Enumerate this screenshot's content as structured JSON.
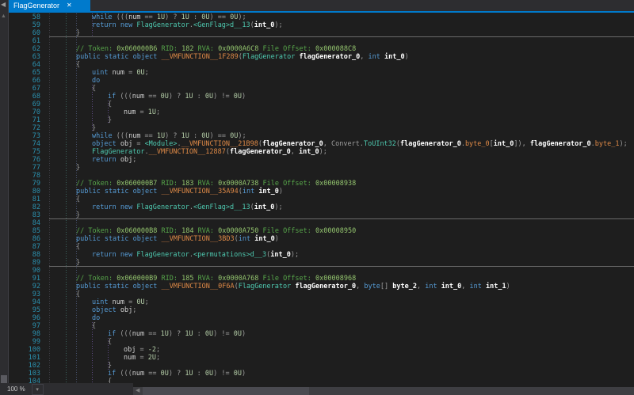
{
  "colors": {
    "accent": "#007ACC",
    "linenum": "#2B91AF",
    "keyword": "#569CD6",
    "type": "#4EC9B0",
    "member": "#DF8A47",
    "parameter": "#FFFFFF",
    "local": "#D4D4D4",
    "punctuation": "#9E9E9E",
    "number": "#B5CEA8",
    "comment": "#57A64A",
    "comment_number": "#93C46E"
  },
  "icons": {
    "tab_close": "✕",
    "dropdown_caret": "▾",
    "scroll_left": "◀",
    "scroll_up": "▲",
    "strip_chevron_left": "◀"
  },
  "tab_bar": {
    "tabs": [
      {
        "label": "FlagGenerator",
        "active": true
      }
    ]
  },
  "status_bar": {
    "zoom_level": "100 %"
  },
  "editor": {
    "first_line": 58,
    "lines": [
      {
        "n": 58,
        "i": 1,
        "s": [
          [
            "k",
            "while"
          ],
          [
            "o",
            " ((("
          ],
          [
            "v",
            "num"
          ],
          [
            "o",
            " == "
          ],
          [
            "n",
            "1U"
          ],
          [
            "o",
            ") ? "
          ],
          [
            "n",
            "1U"
          ],
          [
            "o",
            " : "
          ],
          [
            "n",
            "0U"
          ],
          [
            "o",
            ") == "
          ],
          [
            "n",
            "0U"
          ],
          [
            "o",
            ");"
          ]
        ]
      },
      {
        "n": 59,
        "i": 1,
        "s": [
          [
            "k",
            "return"
          ],
          [
            "o",
            " "
          ],
          [
            "k",
            "new"
          ],
          [
            "o",
            " "
          ],
          [
            "t",
            "FlagGenerator"
          ],
          [
            "o",
            "."
          ],
          [
            "t",
            "<GenFlag>d__13"
          ],
          [
            "o",
            "("
          ],
          [
            "p",
            "int_0"
          ],
          [
            "o",
            ");"
          ]
        ]
      },
      {
        "n": 60,
        "i": 0,
        "sep": true,
        "s": [
          [
            "o",
            "}"
          ]
        ]
      },
      {
        "n": 61
      },
      {
        "n": 62,
        "i": 0,
        "s": [
          [
            "c",
            "// Token: "
          ],
          [
            "d",
            "0x060000B6"
          ],
          [
            "c",
            " RID: "
          ],
          [
            "d",
            "182"
          ],
          [
            "c",
            " RVA: "
          ],
          [
            "d",
            "0x0000A6C8"
          ],
          [
            "c",
            " File Offset: "
          ],
          [
            "d",
            "0x000088C8"
          ]
        ]
      },
      {
        "n": 63,
        "i": 0,
        "s": [
          [
            "k",
            "public static object "
          ],
          [
            "m",
            "__VMFUNCTION__1F289"
          ],
          [
            "o",
            "("
          ],
          [
            "t",
            "FlagGenerator"
          ],
          [
            "o",
            " "
          ],
          [
            "p",
            "flagGenerator_0"
          ],
          [
            "o",
            ", "
          ],
          [
            "k",
            "int"
          ],
          [
            "o",
            " "
          ],
          [
            "p",
            "int_0"
          ],
          [
            "o",
            ")"
          ]
        ]
      },
      {
        "n": 64,
        "i": 0,
        "s": [
          [
            "o",
            "{"
          ]
        ]
      },
      {
        "n": 65,
        "i": 1,
        "s": [
          [
            "k",
            "uint"
          ],
          [
            "o",
            " "
          ],
          [
            "v",
            "num"
          ],
          [
            "o",
            " = "
          ],
          [
            "n",
            "0U"
          ],
          [
            "o",
            ";"
          ]
        ]
      },
      {
        "n": 66,
        "i": 1,
        "s": [
          [
            "k",
            "do"
          ]
        ]
      },
      {
        "n": 67,
        "i": 1,
        "s": [
          [
            "o",
            "{"
          ]
        ]
      },
      {
        "n": 68,
        "i": 2,
        "s": [
          [
            "k",
            "if"
          ],
          [
            "o",
            " ((("
          ],
          [
            "v",
            "num"
          ],
          [
            "o",
            " == "
          ],
          [
            "n",
            "0U"
          ],
          [
            "o",
            ") ? "
          ],
          [
            "n",
            "1U"
          ],
          [
            "o",
            " : "
          ],
          [
            "n",
            "0U"
          ],
          [
            "o",
            ") != "
          ],
          [
            "n",
            "0U"
          ],
          [
            "o",
            ")"
          ]
        ]
      },
      {
        "n": 69,
        "i": 2,
        "s": [
          [
            "o",
            "{"
          ]
        ]
      },
      {
        "n": 70,
        "i": 3,
        "s": [
          [
            "v",
            "num"
          ],
          [
            "o",
            " = "
          ],
          [
            "n",
            "1U"
          ],
          [
            "o",
            ";"
          ]
        ]
      },
      {
        "n": 71,
        "i": 2,
        "s": [
          [
            "o",
            "}"
          ]
        ]
      },
      {
        "n": 72,
        "i": 1,
        "s": [
          [
            "o",
            "}"
          ]
        ]
      },
      {
        "n": 73,
        "i": 1,
        "s": [
          [
            "k",
            "while"
          ],
          [
            "o",
            " ((("
          ],
          [
            "v",
            "num"
          ],
          [
            "o",
            " == "
          ],
          [
            "n",
            "1U"
          ],
          [
            "o",
            ") ? "
          ],
          [
            "n",
            "1U"
          ],
          [
            "o",
            " : "
          ],
          [
            "n",
            "0U"
          ],
          [
            "o",
            ") == "
          ],
          [
            "n",
            "0U"
          ],
          [
            "o",
            ");"
          ]
        ]
      },
      {
        "n": 74,
        "i": 1,
        "s": [
          [
            "k",
            "object"
          ],
          [
            "o",
            " "
          ],
          [
            "v",
            "obj"
          ],
          [
            "o",
            " = "
          ],
          [
            "t",
            "<Module>"
          ],
          [
            "o",
            "."
          ],
          [
            "m",
            "__VMFUNCTION__21B98"
          ],
          [
            "o",
            "("
          ],
          [
            "p",
            "flagGenerator_0"
          ],
          [
            "o",
            ", "
          ],
          [
            "o",
            "Convert"
          ],
          [
            "o",
            "."
          ],
          [
            "t",
            "ToUInt32"
          ],
          [
            "o",
            "("
          ],
          [
            "p",
            "flagGenerator_0"
          ],
          [
            "o",
            "."
          ],
          [
            "m",
            "byte_0"
          ],
          [
            "o",
            "["
          ],
          [
            "p",
            "int_0"
          ],
          [
            "o",
            "]), "
          ],
          [
            "p",
            "flagGenerator_0"
          ],
          [
            "o",
            "."
          ],
          [
            "m",
            "byte_1"
          ],
          [
            "o",
            ");"
          ]
        ]
      },
      {
        "n": 75,
        "i": 1,
        "s": [
          [
            "t",
            "FlagGenerator"
          ],
          [
            "o",
            "."
          ],
          [
            "m",
            "__VMFUNCTION__12887"
          ],
          [
            "o",
            "("
          ],
          [
            "p",
            "flagGenerator_0"
          ],
          [
            "o",
            ", "
          ],
          [
            "p",
            "int_0"
          ],
          [
            "o",
            ");"
          ]
        ]
      },
      {
        "n": 76,
        "i": 1,
        "s": [
          [
            "k",
            "return"
          ],
          [
            "o",
            " "
          ],
          [
            "v",
            "obj"
          ],
          [
            "o",
            ";"
          ]
        ]
      },
      {
        "n": 77,
        "i": 0,
        "s": [
          [
            "o",
            "}"
          ]
        ]
      },
      {
        "n": 78
      },
      {
        "n": 79,
        "i": 0,
        "s": [
          [
            "c",
            "// Token: "
          ],
          [
            "d",
            "0x060000B7"
          ],
          [
            "c",
            " RID: "
          ],
          [
            "d",
            "183"
          ],
          [
            "c",
            " RVA: "
          ],
          [
            "d",
            "0x0000A738"
          ],
          [
            "c",
            " File Offset: "
          ],
          [
            "d",
            "0x00008938"
          ]
        ]
      },
      {
        "n": 80,
        "i": 0,
        "s": [
          [
            "k",
            "public static object "
          ],
          [
            "m",
            "__VMFUNCTION__35A94"
          ],
          [
            "o",
            "("
          ],
          [
            "k",
            "int"
          ],
          [
            "o",
            " "
          ],
          [
            "p",
            "int_0"
          ],
          [
            "o",
            ")"
          ]
        ]
      },
      {
        "n": 81,
        "i": 0,
        "s": [
          [
            "o",
            "{"
          ]
        ]
      },
      {
        "n": 82,
        "i": 1,
        "s": [
          [
            "k",
            "return"
          ],
          [
            "o",
            " "
          ],
          [
            "k",
            "new"
          ],
          [
            "o",
            " "
          ],
          [
            "t",
            "FlagGenerator"
          ],
          [
            "o",
            "."
          ],
          [
            "t",
            "<GenFlag>d__13"
          ],
          [
            "o",
            "("
          ],
          [
            "p",
            "int_0"
          ],
          [
            "o",
            ");"
          ]
        ]
      },
      {
        "n": 83,
        "i": 0,
        "sep": true,
        "s": [
          [
            "o",
            "}"
          ]
        ]
      },
      {
        "n": 84
      },
      {
        "n": 85,
        "i": 0,
        "s": [
          [
            "c",
            "// Token: "
          ],
          [
            "d",
            "0x060000B8"
          ],
          [
            "c",
            " RID: "
          ],
          [
            "d",
            "184"
          ],
          [
            "c",
            " RVA: "
          ],
          [
            "d",
            "0x0000A750"
          ],
          [
            "c",
            " File Offset: "
          ],
          [
            "d",
            "0x00008950"
          ]
        ]
      },
      {
        "n": 86,
        "i": 0,
        "s": [
          [
            "k",
            "public static object "
          ],
          [
            "m",
            "__VMFUNCTION__3BD3"
          ],
          [
            "o",
            "("
          ],
          [
            "k",
            "int"
          ],
          [
            "o",
            " "
          ],
          [
            "p",
            "int_0"
          ],
          [
            "o",
            ")"
          ]
        ]
      },
      {
        "n": 87,
        "i": 0,
        "s": [
          [
            "o",
            "{"
          ]
        ]
      },
      {
        "n": 88,
        "i": 1,
        "s": [
          [
            "k",
            "return"
          ],
          [
            "o",
            " "
          ],
          [
            "k",
            "new"
          ],
          [
            "o",
            " "
          ],
          [
            "t",
            "FlagGenerator"
          ],
          [
            "o",
            "."
          ],
          [
            "t",
            "<permutations>d__3"
          ],
          [
            "o",
            "("
          ],
          [
            "p",
            "int_0"
          ],
          [
            "o",
            ");"
          ]
        ]
      },
      {
        "n": 89,
        "i": 0,
        "sep": true,
        "s": [
          [
            "o",
            "}"
          ]
        ]
      },
      {
        "n": 90
      },
      {
        "n": 91,
        "i": 0,
        "s": [
          [
            "c",
            "// Token: "
          ],
          [
            "d",
            "0x060000B9"
          ],
          [
            "c",
            " RID: "
          ],
          [
            "d",
            "185"
          ],
          [
            "c",
            " RVA: "
          ],
          [
            "d",
            "0x0000A768"
          ],
          [
            "c",
            " File Offset: "
          ],
          [
            "d",
            "0x00008968"
          ]
        ]
      },
      {
        "n": 92,
        "i": 0,
        "s": [
          [
            "k",
            "public static object "
          ],
          [
            "m",
            "__VMFUNCTION__0F6A"
          ],
          [
            "o",
            "("
          ],
          [
            "t",
            "FlagGenerator"
          ],
          [
            "o",
            " "
          ],
          [
            "p",
            "flagGenerator_0"
          ],
          [
            "o",
            ", "
          ],
          [
            "k",
            "byte"
          ],
          [
            "o",
            "[] "
          ],
          [
            "p",
            "byte_2"
          ],
          [
            "o",
            ", "
          ],
          [
            "k",
            "int"
          ],
          [
            "o",
            " "
          ],
          [
            "p",
            "int_0"
          ],
          [
            "o",
            ", "
          ],
          [
            "k",
            "int"
          ],
          [
            "o",
            " "
          ],
          [
            "p",
            "int_1"
          ],
          [
            "o",
            ")"
          ]
        ]
      },
      {
        "n": 93,
        "i": 0,
        "s": [
          [
            "o",
            "{"
          ]
        ]
      },
      {
        "n": 94,
        "i": 1,
        "s": [
          [
            "k",
            "uint"
          ],
          [
            "o",
            " "
          ],
          [
            "v",
            "num"
          ],
          [
            "o",
            " = "
          ],
          [
            "n",
            "0U"
          ],
          [
            "o",
            ";"
          ]
        ]
      },
      {
        "n": 95,
        "i": 1,
        "s": [
          [
            "k",
            "object"
          ],
          [
            "o",
            " "
          ],
          [
            "v",
            "obj"
          ],
          [
            "o",
            ";"
          ]
        ]
      },
      {
        "n": 96,
        "i": 1,
        "s": [
          [
            "k",
            "do"
          ]
        ]
      },
      {
        "n": 97,
        "i": 1,
        "s": [
          [
            "o",
            "{"
          ]
        ]
      },
      {
        "n": 98,
        "i": 2,
        "s": [
          [
            "k",
            "if"
          ],
          [
            "o",
            " ((("
          ],
          [
            "v",
            "num"
          ],
          [
            "o",
            " == "
          ],
          [
            "n",
            "1U"
          ],
          [
            "o",
            ") ? "
          ],
          [
            "n",
            "1U"
          ],
          [
            "o",
            " : "
          ],
          [
            "n",
            "0U"
          ],
          [
            "o",
            ") != "
          ],
          [
            "n",
            "0U"
          ],
          [
            "o",
            ")"
          ]
        ]
      },
      {
        "n": 99,
        "i": 2,
        "s": [
          [
            "o",
            "{"
          ]
        ]
      },
      {
        "n": 100,
        "i": 3,
        "s": [
          [
            "v",
            "obj"
          ],
          [
            "o",
            " = "
          ],
          [
            "n",
            "-2"
          ],
          [
            "o",
            ";"
          ]
        ]
      },
      {
        "n": 101,
        "i": 3,
        "s": [
          [
            "v",
            "num"
          ],
          [
            "o",
            " = "
          ],
          [
            "n",
            "2U"
          ],
          [
            "o",
            ";"
          ]
        ]
      },
      {
        "n": 102,
        "i": 2,
        "s": [
          [
            "o",
            "}"
          ]
        ]
      },
      {
        "n": 103,
        "i": 2,
        "s": [
          [
            "k",
            "if"
          ],
          [
            "o",
            " ((("
          ],
          [
            "v",
            "num"
          ],
          [
            "o",
            " == "
          ],
          [
            "n",
            "0U"
          ],
          [
            "o",
            ") ? "
          ],
          [
            "n",
            "1U"
          ],
          [
            "o",
            " : "
          ],
          [
            "n",
            "0U"
          ],
          [
            "o",
            ") != "
          ],
          [
            "n",
            "0U"
          ],
          [
            "o",
            ")"
          ]
        ]
      },
      {
        "n": 104,
        "i": 2,
        "s": [
          [
            "o",
            "{"
          ]
        ]
      }
    ]
  }
}
